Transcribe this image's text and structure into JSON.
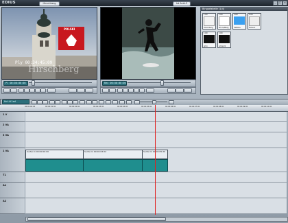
{
  "app": {
    "logo": "EDIUS",
    "project_name": "Hirschberg",
    "preset": "hd Avid-3"
  },
  "player": {
    "overlay_badge": "POLSKI",
    "overlay_timecode": "Ply 00:34:45:09",
    "overlay_city": "Hirschberg",
    "tc_label": "Pl 00:00:00:00"
  },
  "recorder": {
    "tc_label": "Rec 00:00:00:00"
  },
  "bin": {
    "title": "Bingoéabelle (1/4)",
    "items": [
      {
        "duration": "1:00",
        "name": "Hirschberg",
        "color": "#f3f3f3"
      },
      {
        "duration": "1:00",
        "name": "Prince/Berg",
        "color": "#ffffff"
      },
      {
        "duration": "1:00",
        "name": "hellblau",
        "color": "#3aa0f0"
      },
      {
        "duration": "1:00",
        "name": "Farbe 4",
        "color": "#eeeeee"
      },
      {
        "duration": "1:00",
        "name": "grün",
        "color": "#101010"
      },
      {
        "duration": "1:00",
        "name": "schwarz",
        "color": "#101010"
      }
    ]
  },
  "timeline": {
    "sequence_name": "Untitled",
    "ruler_ticks": [
      "00:00:00:00",
      "00:00:01:00",
      "00:00:02:00",
      "00:00:03:00",
      "00:00:04:00",
      "00:00:05:00",
      "00:00:06:00",
      "00:00:07:00",
      "00:00:08:00",
      "00:00:09:00",
      "00:00:10:00"
    ],
    "tracks": [
      {
        "label": "1 V",
        "kind": "video"
      },
      {
        "label": "2 VA",
        "kind": "video"
      },
      {
        "label": "3 VA",
        "kind": "video"
      },
      {
        "label": "1 VA",
        "kind": "va"
      },
      {
        "label": "T1",
        "kind": "title"
      },
      {
        "label": "A1",
        "kind": "audio"
      },
      {
        "label": "A2",
        "kind": "audio"
      }
    ],
    "clips": [
      {
        "label": "Surfer.m 00:00:00:00"
      },
      {
        "label": "Surfer.m 00:00:03:02"
      },
      {
        "label": "Surfer.m 00:00:05:20"
      }
    ]
  },
  "colors": {
    "accent_teal": "#2c6f7b",
    "cursor_red": "#e02020",
    "audio_green": "#1f8e8e"
  }
}
